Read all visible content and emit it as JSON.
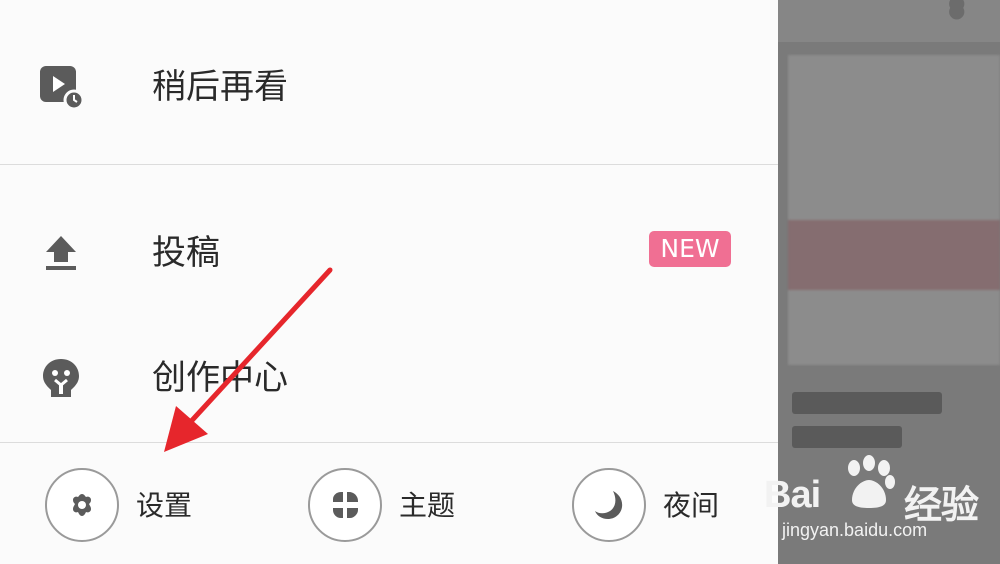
{
  "drawer": {
    "items": [
      {
        "label": "稍后再看",
        "icon": "watch-later-icon"
      },
      {
        "label": "投稿",
        "icon": "upload-icon",
        "badge": "NEW"
      },
      {
        "label": "创作中心",
        "icon": "creator-bulb-icon"
      }
    ],
    "bottom": [
      {
        "label": "设置",
        "icon": "settings-gear-icon"
      },
      {
        "label": "主题",
        "icon": "theme-icon"
      },
      {
        "label": "夜间",
        "icon": "night-moon-icon"
      }
    ]
  },
  "watermark": {
    "brand": "Bai",
    "brand_suffix": "经验",
    "url": "jingyan.baidu.com"
  },
  "colors": {
    "badge": "#f06f93",
    "arrow": "#e6262c",
    "icon": "#555555"
  }
}
